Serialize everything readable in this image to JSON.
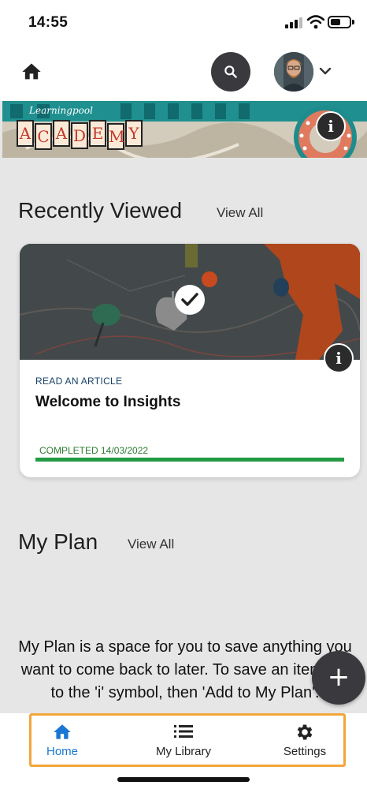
{
  "status_bar": {
    "time": "14:55"
  },
  "top_nav": {
    "icons": [
      "home-icon",
      "search-icon",
      "avatar",
      "chevron-down-icon"
    ]
  },
  "banner": {
    "logo_small": "Learningpool",
    "logo_letters": [
      "A",
      "C",
      "A",
      "D",
      "E",
      "M",
      "Y"
    ]
  },
  "recently_viewed": {
    "title": "Recently Viewed",
    "view_all": "View All",
    "card": {
      "type_label": "READ AN ARTICLE",
      "title": "Welcome to Insights",
      "status": "COMPLETED 14/03/2022",
      "progress": 1.0
    }
  },
  "my_plan": {
    "title": "My Plan",
    "view_all": "View All",
    "description": "My Plan is a space for you to save anything you want to come back to later. To save an item, go to the 'i' symbol, then 'Add to My Plan'."
  },
  "fab": {
    "label": "+"
  },
  "bottom_nav": {
    "tabs": [
      {
        "label": "Home",
        "icon": "home-icon",
        "active": true
      },
      {
        "label": "My Library",
        "icon": "list-icon",
        "active": false
      },
      {
        "label": "Settings",
        "icon": "gear-icon",
        "active": false
      }
    ]
  },
  "colors": {
    "accent": "#1976d2",
    "progress": "#239b45",
    "highlight_outline": "#f2a63a",
    "fab": "#3a3a3e"
  }
}
